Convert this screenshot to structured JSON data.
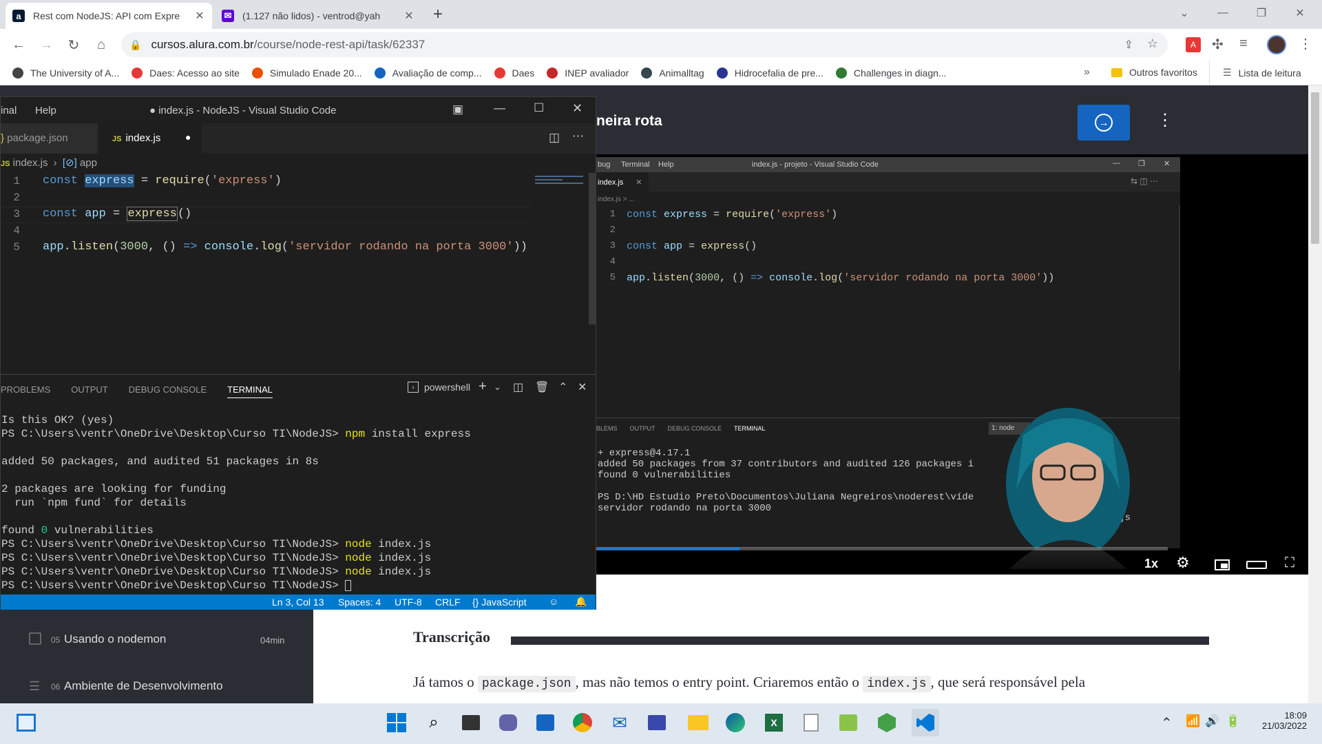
{
  "browser": {
    "tabs": [
      {
        "title": "Rest com NodeJS: API com Expre",
        "active": true,
        "icon": "alura-favicon"
      },
      {
        "title": "(1.127 não lidos) - ventrod@yah",
        "active": false,
        "icon": "yahoo-mail-favicon"
      }
    ],
    "url_host": "cursos.alura.com.br",
    "url_path": "/course/node-rest-api/task/62337",
    "bookmarks": [
      {
        "label": "The University of A...",
        "color": "#444444"
      },
      {
        "label": "Daes: Acesso ao site",
        "color": "#e53935"
      },
      {
        "label": "Simulado Enade 20...",
        "color": "#e65100"
      },
      {
        "label": "Avaliação de comp...",
        "color": "#1565c0"
      },
      {
        "label": "Daes",
        "color": "#e53935"
      },
      {
        "label": "INEP avaliador",
        "color": "#c62828"
      },
      {
        "label": "Animalltag",
        "color": "#37474f"
      },
      {
        "label": "Hidrocefalia de pre...",
        "color": "#283593"
      },
      {
        "label": "Challenges in diagn...",
        "color": "#2e7d32"
      }
    ],
    "bookmarks_more": "»",
    "other_favorites": "Outros favoritos",
    "reading_list": "Lista de leitura"
  },
  "alura": {
    "lesson_title_partial": "neira rota",
    "transcript_heading": "Transcrição",
    "transcript_text_1": "Já tamos o ",
    "transcript_code_1": "package.json",
    "transcript_text_2": ", mas não temos o entry point. Criaremos então o ",
    "transcript_code_2": "index.js",
    "transcript_text_3": ", que será responsável pela",
    "sidebar_items": [
      {
        "number": "05",
        "label": "Usando o nodemon",
        "duration": "04min"
      },
      {
        "number": "06",
        "label": "Ambiente de Desenvolvimento",
        "duration": ""
      }
    ],
    "video_speed": "1x",
    "video_progress": 0.25
  },
  "video_vscode": {
    "menu": [
      "bug",
      "Terminal",
      "Help"
    ],
    "title": "index.js - projeto - Visual Studio Code",
    "tab": "index.js",
    "breadcrumb": "index.js > ...",
    "line_numbers": [
      "1",
      "2",
      "3",
      "4",
      "5"
    ],
    "panel_tabs": [
      "BLEMS",
      "OUTPUT",
      "DEBUG CONSOLE",
      "TERMINAL"
    ],
    "terminal_select": "1: node",
    "terminal_lines": [
      "+ express@4.17.1",
      "added 50 packages from 37 contributors and audited 126 packages i",
      "found 0 vulnerabilities",
      "",
      "PS D:\\HD Estudio Preto\\Documentos\\Juliana Negreiros\\noderest\\víde",
      "servidor rodando na porta 3000"
    ],
    "terminal_suffix": "ex.js"
  },
  "vscode": {
    "menu_partial": "inal",
    "menu_help": "Help",
    "title": "● index.js - NodeJS - Visual Studio Code",
    "tabs": [
      {
        "label": "package.json",
        "active": false
      },
      {
        "label": "index.js",
        "active": true
      }
    ],
    "breadcrumb_file": "index.js",
    "breadcrumb_symbol": "app",
    "line_numbers": [
      "1",
      "2",
      "3",
      "4",
      "5"
    ],
    "panel_tabs": [
      "PROBLEMS",
      "OUTPUT",
      "DEBUG CONSOLE",
      "TERMINAL"
    ],
    "shell": "powershell",
    "terminal_lines": [
      {
        "text": "Is this OK? (yes)"
      },
      {
        "prompt": "PS C:\\Users\\ventr\\OneDrive\\Desktop\\Curso TI\\NodeJS> ",
        "cmd": "npm",
        "args": " install express"
      },
      {
        "text": ""
      },
      {
        "text": "added 50 packages, and audited 51 packages in 8s"
      },
      {
        "text": ""
      },
      {
        "text": "2 packages are looking for funding"
      },
      {
        "text": "  run `npm fund` for details"
      },
      {
        "text": ""
      },
      {
        "text": "found ",
        "green": "0",
        "rest": " vulnerabilities"
      },
      {
        "prompt": "PS C:\\Users\\ventr\\OneDrive\\Desktop\\Curso TI\\NodeJS> ",
        "cmd": "node",
        "args": " index.js"
      },
      {
        "prompt": "PS C:\\Users\\ventr\\OneDrive\\Desktop\\Curso TI\\NodeJS> ",
        "cmd": "node",
        "args": " index.js"
      },
      {
        "prompt": "PS C:\\Users\\ventr\\OneDrive\\Desktop\\Curso TI\\NodeJS> ",
        "cmd": "node",
        "args": " index.js"
      },
      {
        "prompt": "PS C:\\Users\\ventr\\OneDrive\\Desktop\\Curso TI\\NodeJS> ",
        "cmd": "",
        "args": ""
      }
    ],
    "status": {
      "position": "Ln 3, Col 13",
      "spaces": "Spaces: 4",
      "encoding": "UTF-8",
      "eol": "CRLF",
      "language": "{} JavaScript"
    }
  },
  "taskbar": {
    "time": "18:09",
    "date": "21/03/2022"
  }
}
